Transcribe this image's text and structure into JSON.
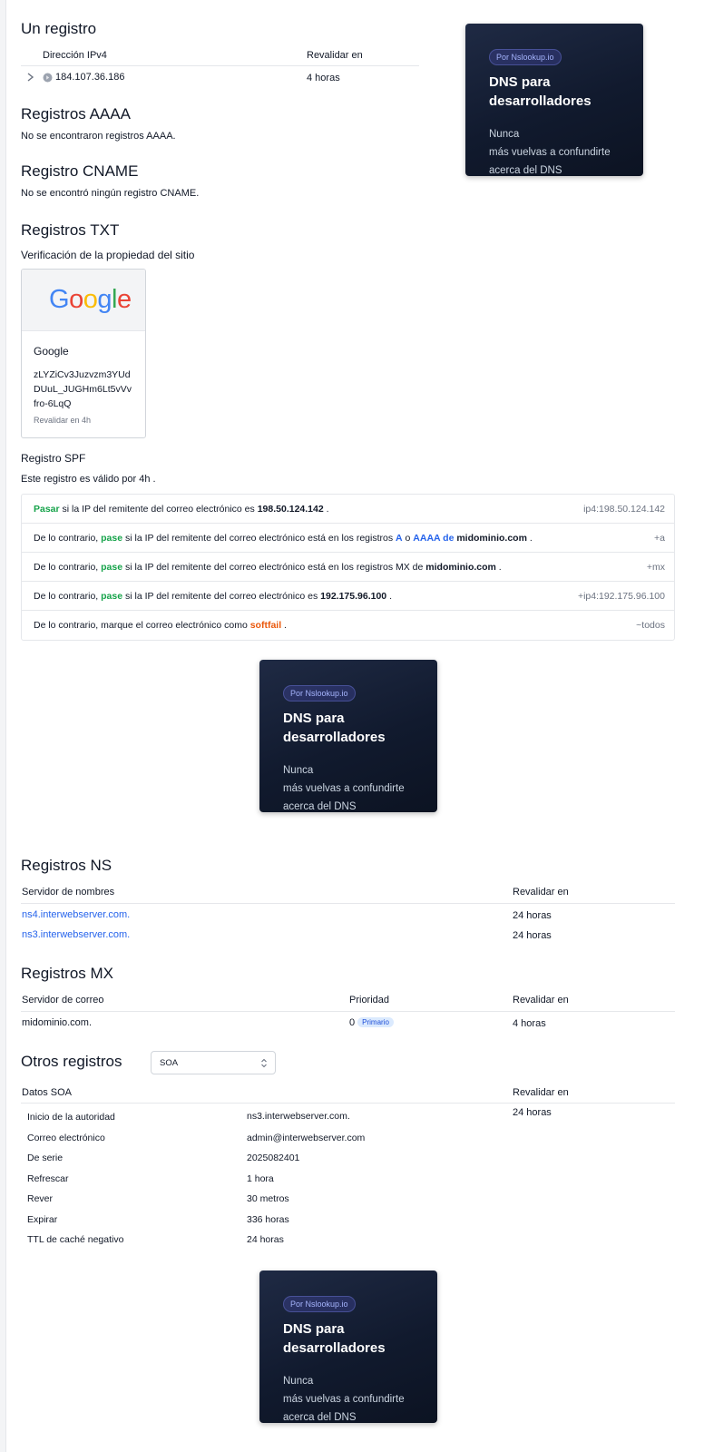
{
  "a_section": {
    "title": "Un registro",
    "col_ip": "Dirección IPv4",
    "col_revalidate": "Revalidar en",
    "rows": [
      {
        "ip": "184.107.36.186",
        "revalidate": "4 horas"
      }
    ]
  },
  "aaaa_section": {
    "title": "Registros AAAA",
    "empty": "No se encontraron registros AAAA."
  },
  "cname_section": {
    "title": "Registro CNAME",
    "empty": "No se encontró ningún registro CNAME."
  },
  "txt_section": {
    "title": "Registros TXT",
    "verification_title": "Verificación de la propiedad del sitio",
    "card": {
      "logo_letters": [
        "G",
        "o",
        "o",
        "g",
        "l",
        "e"
      ],
      "logo_colors": [
        "#4285F4",
        "#EA4335",
        "#FBBC05",
        "#4285F4",
        "#34A853",
        "#EA4335"
      ],
      "name": "Google",
      "token_lines": [
        "zLYZiCv3Juzvzm3YUd",
        "DUuL_JUGHm6Lt5vVv",
        "fro-6LqQ"
      ],
      "revalidate": "Revalidar en 4h"
    }
  },
  "spf": {
    "title": "Registro SPF",
    "validity": "Este registro es válido por 4h .",
    "rows": [
      {
        "tag": "ip4:198.50.124.142"
      },
      {
        "tag": "+a"
      },
      {
        "tag": "+mx"
      },
      {
        "tag": "+ip4:192.175.96.100"
      },
      {
        "tag": "~todos"
      }
    ],
    "text": {
      "pass_cap": "Pasar",
      "pass": "pase",
      "otherwise": "De lo contrario,",
      "if_ip_is": " si la IP del remitente del correo electrónico es ",
      "if_ip_in": " si la IP del remitente del correo electrónico está en los registros ",
      "mx_in": "MX de ",
      "a": "A",
      "o": " o ",
      "aaaa_de": "AAAA de",
      "domain": "midominio.com",
      "ip1": "198.50.124.142",
      "ip2": "192.175.96.100",
      "dot": " .",
      "mark_as": " marque el correo electrónico como ",
      "softfail": "softfail"
    }
  },
  "ad": {
    "pill": "Por Nslookup.io",
    "title": "DNS para desarrolladores",
    "sub_line1": "Nunca",
    "sub_line2": "más vuelvas a confundirte",
    "sub_line3": "acerca del DNS"
  },
  "ns_section": {
    "title": "Registros NS",
    "col_server": "Servidor de nombres",
    "col_revalidate": "Revalidar en",
    "rows": [
      {
        "server": "ns4.interwebserver.com.",
        "revalidate": "24 horas"
      },
      {
        "server": "ns3.interwebserver.com.",
        "revalidate": "24 horas"
      }
    ]
  },
  "mx_section": {
    "title": "Registros MX",
    "col_server": "Servidor de correo",
    "col_priority": "Prioridad",
    "col_revalidate": "Revalidar en",
    "rows": [
      {
        "server": "midominio.com.",
        "priority": "0",
        "badge": "Primario",
        "revalidate": "4 horas"
      }
    ]
  },
  "other_section": {
    "title": "Otros registros",
    "select_value": "SOA",
    "col_data": "Datos SOA",
    "col_revalidate": "Revalidar en",
    "revalidate": "24 horas",
    "soa": [
      {
        "key": "Inicio de la autoridad",
        "value": "ns3.interwebserver.com."
      },
      {
        "key": "Correo electrónico",
        "value": "admin@interwebserver.com"
      },
      {
        "key": "De serie",
        "value": "2025082401"
      },
      {
        "key": "Refrescar",
        "value": "1 hora"
      },
      {
        "key": "Rever",
        "value": "30 metros"
      },
      {
        "key": "Expirar",
        "value": "336 horas"
      },
      {
        "key": "TTL de caché negativo",
        "value": "24 horas"
      }
    ]
  }
}
